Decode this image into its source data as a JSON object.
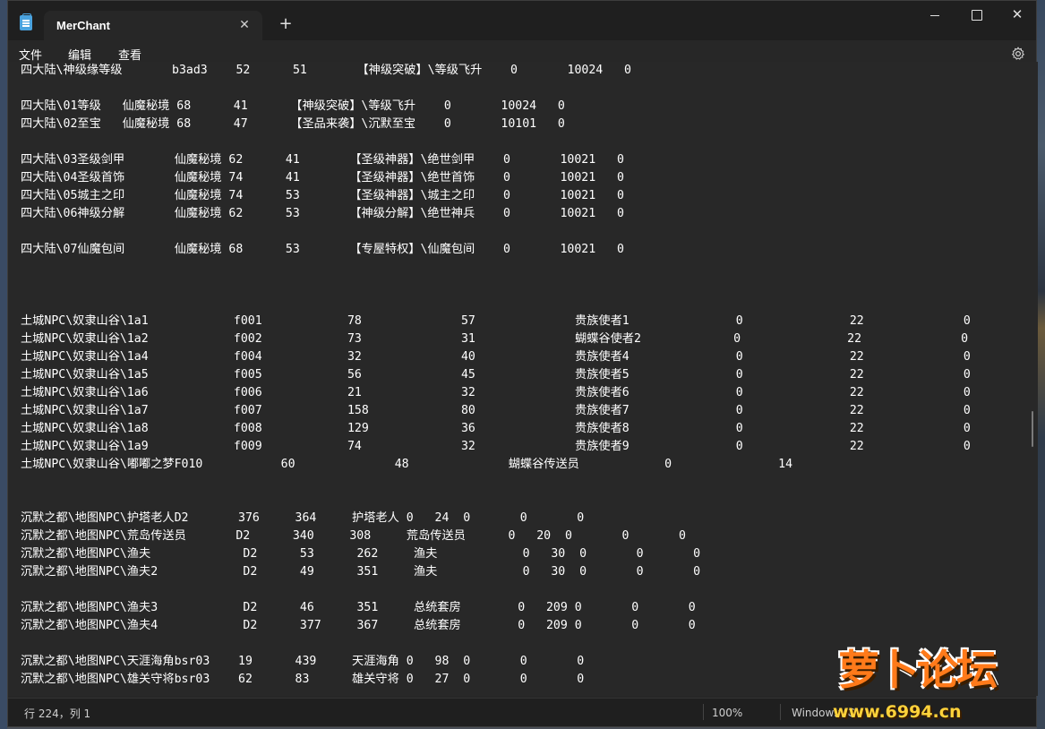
{
  "window": {
    "tab_title": "MerChant",
    "tab_close": "✕",
    "new_tab": "+",
    "minimize": "",
    "maximize": "",
    "close": "✕"
  },
  "menu": {
    "file": "文件",
    "edit": "编辑",
    "view": "查看",
    "settings_icon": "gear-icon"
  },
  "editor": {
    "lines": [
      "四大陆\\神级缘等级       b3ad3    52      51       【神级突破】\\等级飞升    0       10024   0",
      "",
      "四大陆\\01等级   仙魔秘境 68      41      【神级突破】\\等级飞升    0       10024   0",
      "四大陆\\02至宝   仙魔秘境 68      47      【圣品来袭】\\沉默至宝    0       10101   0",
      "",
      "四大陆\\03圣级剑甲       仙魔秘境 62      41       【圣级神器】\\绝世剑甲    0       10021   0",
      "四大陆\\04圣级首饰       仙魔秘境 74      41       【圣级神器】\\绝世首饰    0       10021   0",
      "四大陆\\05城主之印       仙魔秘境 74      53       【圣级神器】\\城主之印    0       10021   0",
      "四大陆\\06神级分解       仙魔秘境 62      53       【神级分解】\\绝世神兵    0       10021   0",
      "",
      "四大陆\\07仙魔包间       仙魔秘境 68      53       【专屋特权】\\仙魔包间    0       10021   0",
      "",
      "",
      "",
      "土城NPC\\奴隶山谷\\1a1            f001            78              57              贵族使者1               0               22              0",
      "土城NPC\\奴隶山谷\\1a2            f002            73              31              蝴蝶谷使者2             0               22              0",
      "土城NPC\\奴隶山谷\\1a4            f004            32              40              贵族使者4               0               22              0",
      "土城NPC\\奴隶山谷\\1a5            f005            56              45              贵族使者5               0               22              0",
      "土城NPC\\奴隶山谷\\1a6            f006            21              32              贵族使者6               0               22              0",
      "土城NPC\\奴隶山谷\\1a7            f007            158             80              贵族使者7               0               22              0",
      "土城NPC\\奴隶山谷\\1a8            f008            129             36              贵族使者8               0               22              0",
      "土城NPC\\奴隶山谷\\1a9            f009            74              32              贵族使者9               0               22              0",
      "土城NPC\\奴隶山谷\\嘟嘟之梦F010           60              48              蝴蝶谷传送员            0               14",
      "",
      "",
      "沉默之都\\地图NPC\\护塔老人D2       376     364     护塔老人 0   24  0       0       0",
      "沉默之都\\地图NPC\\荒岛传送员       D2      340     308     荒岛传送员      0   20  0       0       0",
      "沉默之都\\地图NPC\\渔夫             D2      53      262     渔夫            0   30  0       0       0",
      "沉默之都\\地图NPC\\渔夫2            D2      49      351     渔夫            0   30  0       0       0",
      "",
      "沉默之都\\地图NPC\\渔夫3            D2      46      351     总统套房        0   209 0       0       0",
      "沉默之都\\地图NPC\\渔夫4            D2      377     367     总统套房        0   209 0       0       0",
      "",
      "沉默之都\\地图NPC\\天涯海角bsr03    19      439     天涯海角 0   98  0       0       0",
      "沉默之都\\地图NPC\\雄关守将bsr03    62      83      雄关守将 0   27  0       0       0"
    ]
  },
  "status": {
    "position": "行 224，列 1",
    "zoom": "100%",
    "line_ending": "Windows (C"
  },
  "watermark": {
    "title": "萝卜论坛",
    "url": "www.6994.cn"
  }
}
